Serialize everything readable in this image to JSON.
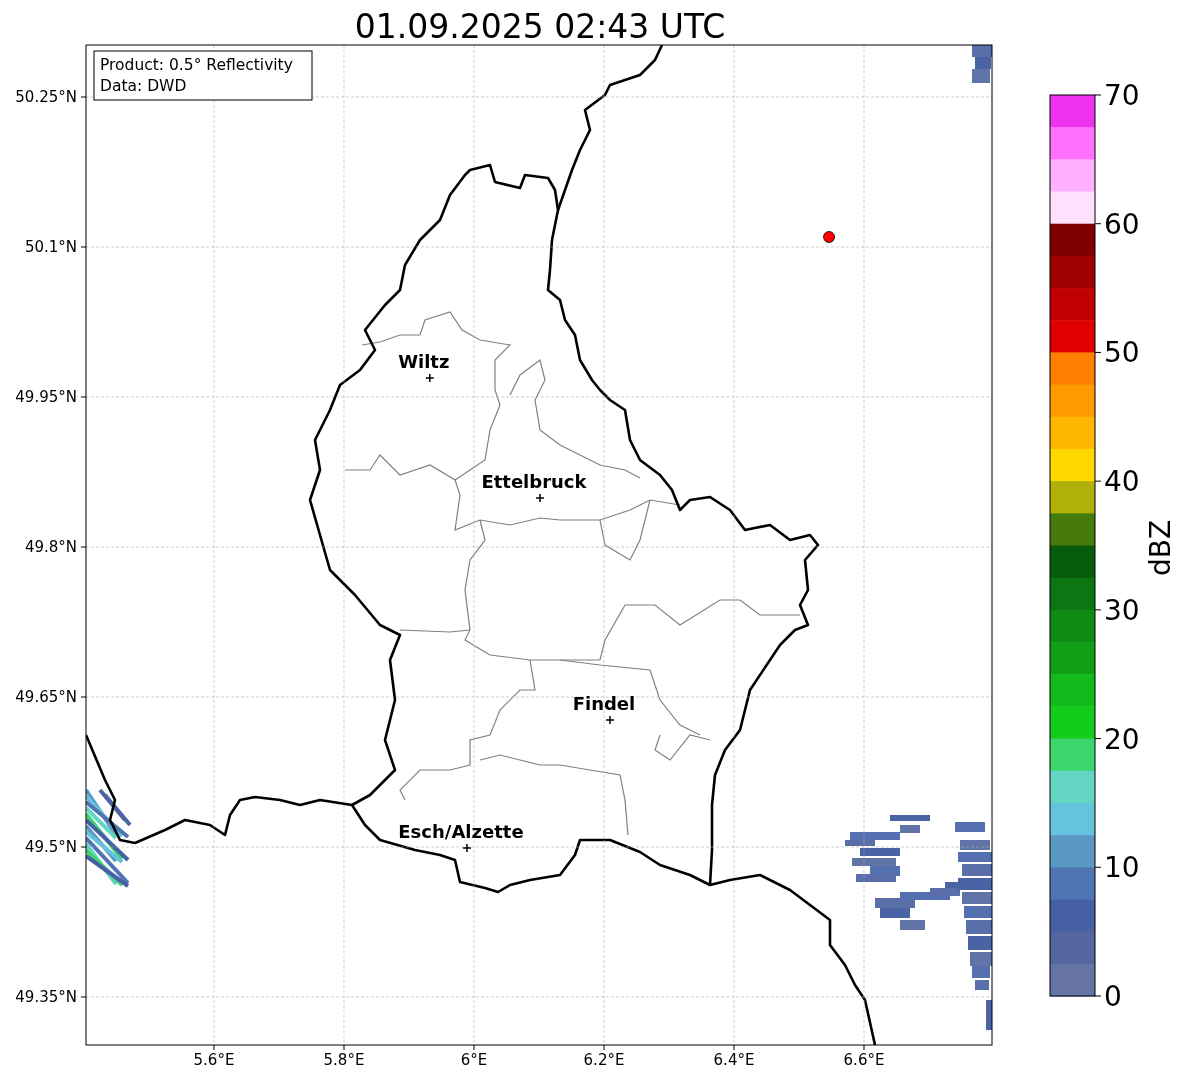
{
  "figure": {
    "info_box": [
      "Product: 0.5° Reflectivity",
      "Data: DWD"
    ],
    "chart_data": {
      "type": "scatter",
      "title": "01.09.2025 02:43 UTC",
      "grid": true,
      "xlim": [
        5.4031,
        6.7969
      ],
      "ylim": [
        49.302,
        50.302
      ],
      "xticks": [
        {
          "value": 5.6,
          "label": "5.6°E"
        },
        {
          "value": 5.8,
          "label": "5.8°E"
        },
        {
          "value": 6.0,
          "label": "6°E"
        },
        {
          "value": 6.2,
          "label": "6.2°E"
        },
        {
          "value": 6.4,
          "label": "6.4°E"
        },
        {
          "value": 6.6,
          "label": "6.6°E"
        }
      ],
      "yticks": [
        {
          "value": 50.25,
          "label": "50.25°N"
        },
        {
          "value": 50.1,
          "label": "50.1°N"
        },
        {
          "value": 49.95,
          "label": "49.95°N"
        },
        {
          "value": 49.8,
          "label": "49.8°N"
        },
        {
          "value": 49.65,
          "label": "49.65°N"
        },
        {
          "value": 49.5,
          "label": "49.5°N"
        },
        {
          "value": 49.35,
          "label": "49.35°N"
        }
      ],
      "x": [
        5.932,
        6.1015,
        6.2092,
        5.9892,
        6.5462
      ],
      "series": [
        {
          "color": "#000000",
          "values": [
            49.969,
            49.849,
            49.627,
            49.499,
            null
          ]
        },
        {
          "color": "#ff0000",
          "values": [
            null,
            null,
            null,
            null,
            50.11
          ]
        }
      ],
      "annotations": [
        {
          "text": "Wiltz",
          "x": 5.932,
          "y": 49.969
        },
        {
          "text": "Ettelbruck",
          "x": 6.1015,
          "y": 49.849
        },
        {
          "text": "Findel",
          "x": 6.2092,
          "y": 49.627
        },
        {
          "text": "Esch/Alzette",
          "x": 5.9892,
          "y": 49.499
        }
      ]
    },
    "colorbar": {
      "label": "dBZ",
      "ticks": [
        "70",
        "60",
        "50",
        "40",
        "30",
        "20",
        "10",
        "0"
      ],
      "bands": [
        {
          "color": "#ee33ee"
        },
        {
          "color": "#ff70ff"
        },
        {
          "color": "#ffb0ff"
        },
        {
          "color": "#ffe0ff"
        },
        {
          "color": "#800000"
        },
        {
          "color": "#a00000"
        },
        {
          "color": "#c00000"
        },
        {
          "color": "#e00000"
        },
        {
          "color": "#ff7f00"
        },
        {
          "color": "#ff9a00"
        },
        {
          "color": "#ffb700"
        },
        {
          "color": "#ffd800"
        },
        {
          "color": "#b0b008"
        },
        {
          "color": "#467a0a"
        },
        {
          "color": "#075c0c"
        },
        {
          "color": "#0b7612"
        },
        {
          "color": "#0e8c14"
        },
        {
          "color": "#10a018"
        },
        {
          "color": "#12bb1b"
        },
        {
          "color": "#14cc1c"
        },
        {
          "color": "#3dd66c"
        },
        {
          "color": "#62d6c3"
        },
        {
          "color": "#66c3dd"
        },
        {
          "color": "#5a99c4"
        },
        {
          "color": "#4f74b3"
        },
        {
          "color": "#4660a6"
        },
        {
          "color": "#55659f"
        },
        {
          "color": "#6673a5"
        }
      ]
    }
  }
}
